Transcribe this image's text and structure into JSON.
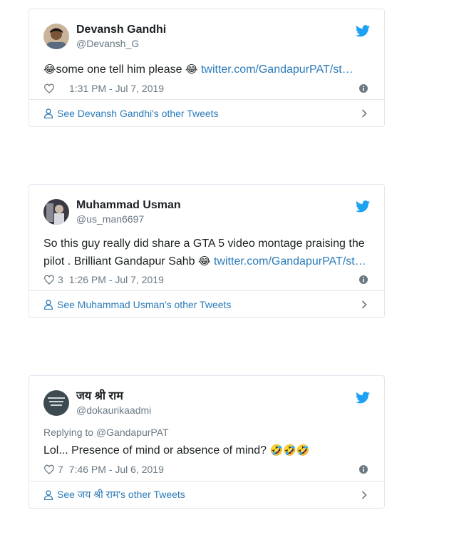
{
  "colors": {
    "link": "#2b7bb9",
    "muted": "#697882",
    "border": "#e1e8ed",
    "twitter_blue": "#1da1f2"
  },
  "tweets": [
    {
      "name": "Devansh Gandhi",
      "handle": "@Devansh_G",
      "reply_to": "",
      "text_pre": "some one tell him please ",
      "link": "twitter.com/GandapurPAT/st…",
      "likes": "",
      "time": "1:31 PM - Jul 7, 2019",
      "footer": "See Devansh Gandhi's other Tweets"
    },
    {
      "name": "Muhammad Usman",
      "handle": "@us_man6697",
      "reply_to": "",
      "text_pre": "So this guy really did share a GTA 5 video montage praising the pilot . Brilliant Gandapur Sahb ",
      "link": "twitter.com/GandapurPAT/st…",
      "likes": "3",
      "time": "1:26 PM - Jul 7, 2019",
      "footer": "See Muhammad Usman's other Tweets"
    },
    {
      "name": "जय श्री राम",
      "handle": "@dokaurikaadmi",
      "reply_to": "Replying to @GandapurPAT",
      "text_pre": "Lol... Presence of mind or absence of mind? ",
      "link": "",
      "likes": "7",
      "time": "7:46 PM - Jul 6, 2019",
      "footer": "See जय श्री राम's other Tweets"
    }
  ]
}
